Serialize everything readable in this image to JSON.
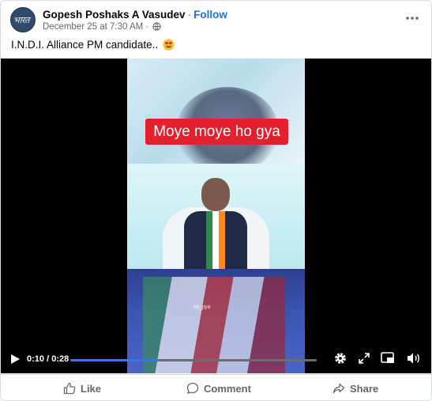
{
  "post": {
    "author": "Gopesh Poshaks A Vasudev",
    "separator": "·",
    "follow_label": "Follow",
    "date": "December 25 at 7:30 AM",
    "date_separator": "·",
    "avatar_text": "भारत",
    "caption": "I.N.D.I. Alliance PM candidate..",
    "caption_emoji": "heart-eyes-emoji-icon"
  },
  "video": {
    "banner_text": "Moye moye ho gya",
    "watermark": "its_jiya",
    "current_time": "0:10",
    "time_separator": "/",
    "duration": "0:28",
    "progress": 0.36
  },
  "actions": {
    "like": "Like",
    "comment": "Comment",
    "share": "Share"
  },
  "colors": {
    "follow": "#1b74e4",
    "banner": "#e5202e",
    "seek_fill": "#3578e5"
  }
}
